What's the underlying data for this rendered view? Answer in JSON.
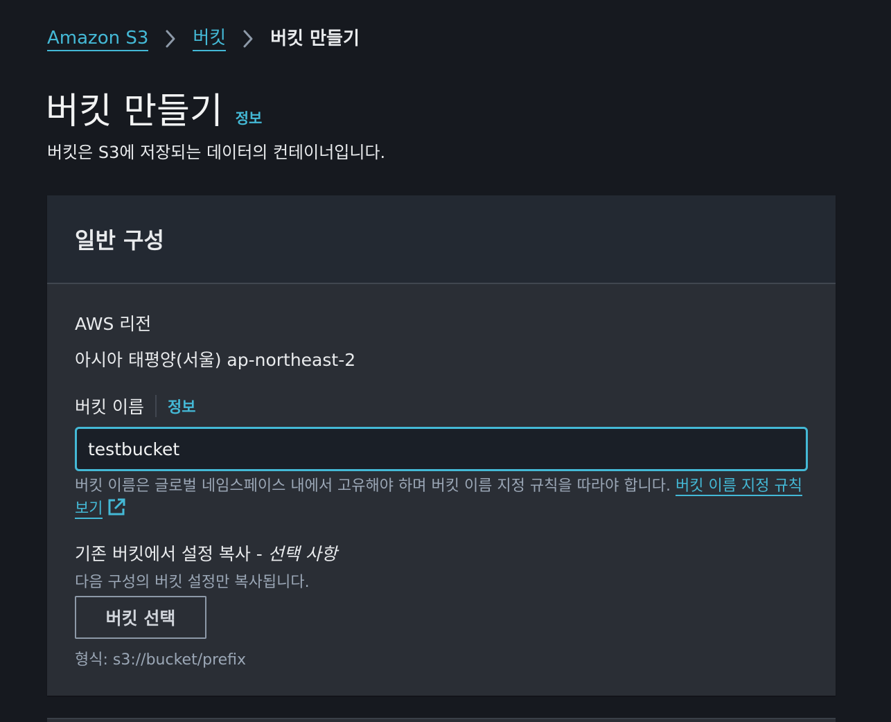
{
  "breadcrumb": {
    "items": [
      {
        "label": "Amazon S3"
      },
      {
        "label": "버킷"
      },
      {
        "label": "버킷 만들기"
      }
    ],
    "separator_icon": "chevron-right-icon"
  },
  "header": {
    "title": "버킷 만들기",
    "info_label": "정보",
    "description": "버킷은 S3에 저장되는 데이터의 컨테이너입니다."
  },
  "general_config": {
    "title": "일반 구성",
    "region": {
      "label": "AWS 리전",
      "value": "아시아 태평양(서울) ap-northeast-2"
    },
    "bucket_name": {
      "label": "버킷 이름",
      "info_label": "정보",
      "value": "testbucket",
      "constraint_text": "버킷 이름은 글로벌 네임스페이스 내에서 고유해야 하며 버킷 이름 지정 규칙을 따라야 합니다.",
      "rules_link": "버킷 이름 지정 규칙 보기",
      "rules_link_icon": "external-link-icon"
    },
    "copy_settings": {
      "label": "기존 버킷에서 설정 복사 - ",
      "optional": "선택 사항",
      "description": "다음 구성의 버킷 설정만 복사됩니다.",
      "button_label": "버킷 선택",
      "format_hint": "형식: s3://bucket/prefix"
    }
  },
  "colors": {
    "background": "#16191f",
    "panel": "#2a2e35",
    "panel_header": "#232932",
    "accent": "#44b9d6"
  }
}
